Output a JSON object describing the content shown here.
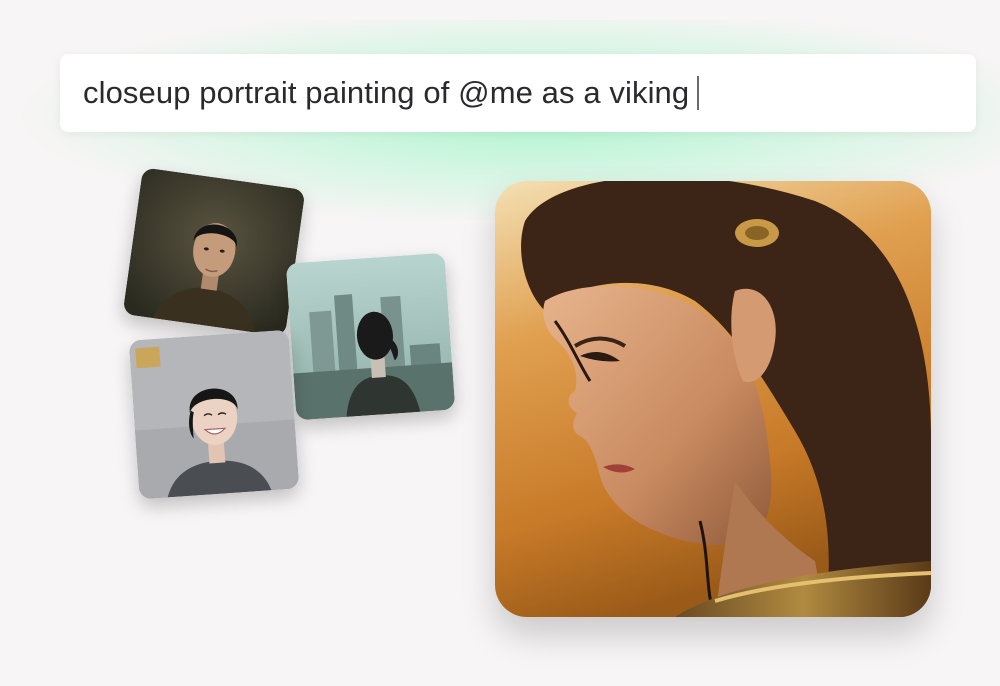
{
  "prompt": {
    "text": "closeup portrait painting of @me as a viking"
  },
  "reference_photos": [
    {
      "icon": "portrait-photo-dark-background"
    },
    {
      "icon": "portrait-photo-city-background"
    },
    {
      "icon": "portrait-photo-smiling-grey-background"
    }
  ],
  "generated_image": {
    "icon": "viking-portrait-painting"
  },
  "colors": {
    "page_background": "#f7f5f5",
    "glow": "#aaf5cd",
    "input_background": "#ffffff",
    "text": "#2a2a2e"
  }
}
